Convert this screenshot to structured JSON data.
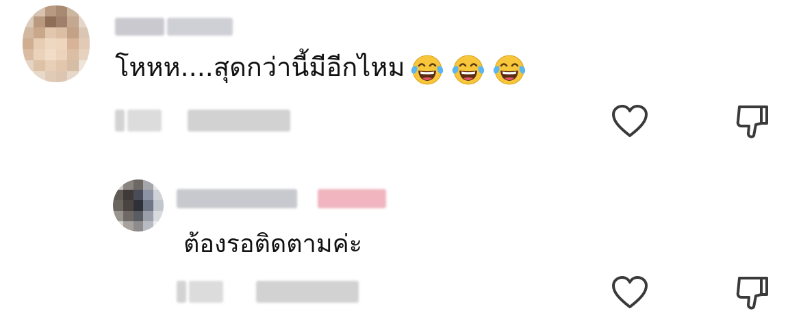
{
  "comments": [
    {
      "text": "โหหห....สุดกว่านี้มีอีกไหม",
      "emojis": [
        "face-with-tears-of-joy",
        "face-with-tears-of-joy",
        "face-with-tears-of-joy"
      ],
      "username_redacted": true,
      "meta_redacted": true
    },
    {
      "text": "ต้องรอติดตามค่ะ",
      "username_redacted": true,
      "author_badge_redacted": true,
      "meta_redacted": true
    }
  ],
  "actions": {
    "like_icon": "heart-outline-icon",
    "dislike_icon": "thumbs-down-outline-icon"
  },
  "colors": {
    "background": "#ffffff",
    "text": "#111111",
    "icon": "#3a3a3a",
    "redacted_gray": "#cfcfcf",
    "redacted_pink": "#f0b5bf"
  }
}
